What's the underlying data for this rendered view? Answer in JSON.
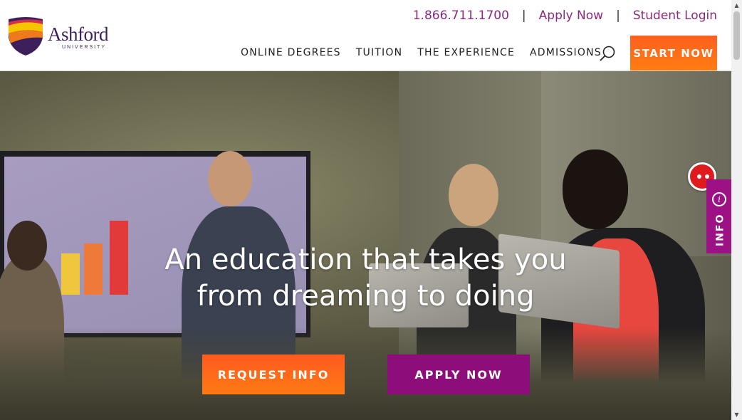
{
  "brand": {
    "name": "Ashford",
    "sub": "UNIVERSITY"
  },
  "topbar": {
    "phone": "1.866.711.1700",
    "apply_link": "Apply Now",
    "login_link": "Student Login",
    "separator": "|"
  },
  "nav": {
    "items": [
      "ONLINE DEGREES",
      "TUITION",
      "THE EXPERIENCE",
      "ADMISSIONS"
    ],
    "start_button": "START NOW"
  },
  "hero": {
    "title_line1": "An education that takes you",
    "title_line2": "from dreaming to doing",
    "request_button": "REQUEST INFO",
    "apply_button": "APPLY NOW"
  },
  "side": {
    "info_label": "INFO",
    "info_icon_glyph": "i"
  },
  "colors": {
    "brand_purple": "#8a2a7e",
    "cta_orange": "#ff6a1a",
    "apply_magenta": "#8d0e7a",
    "info_tab": "#9c1285",
    "chat_red": "#e01b1b"
  },
  "icons": [
    "shield-logo-icon",
    "search-icon",
    "chat-icon",
    "info-icon",
    "scroll-up-icon",
    "scroll-down-icon"
  ]
}
